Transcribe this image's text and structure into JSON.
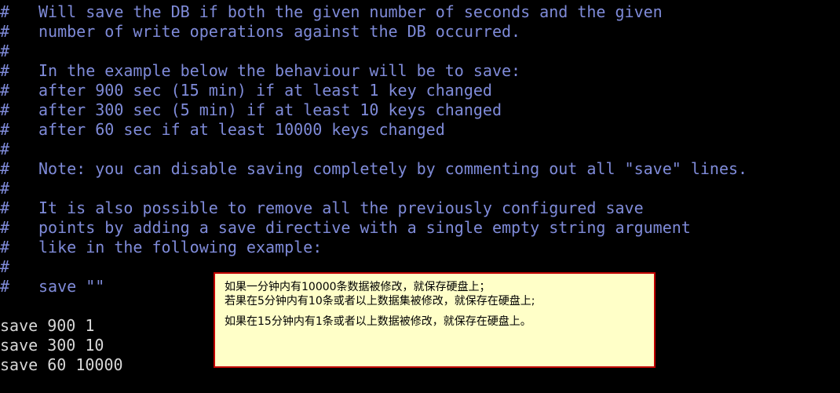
{
  "terminal": {
    "comment_lines": [
      {
        "hash": "#",
        "text": "Will save the DB if both the given number of seconds and the given"
      },
      {
        "hash": "#",
        "text": "number of write operations against the DB occurred."
      },
      {
        "hash": "#",
        "text": ""
      },
      {
        "hash": "#",
        "text": "In the example below the behaviour will be to save:"
      },
      {
        "hash": "#",
        "text": "after 900 sec (15 min) if at least 1 key changed"
      },
      {
        "hash": "#",
        "text": "after 300 sec (5 min) if at least 10 keys changed"
      },
      {
        "hash": "#",
        "text": "after 60 sec if at least 10000 keys changed"
      },
      {
        "hash": "#",
        "text": ""
      },
      {
        "hash": "#",
        "text": "Note: you can disable saving completely by commenting out all \"save\" lines."
      },
      {
        "hash": "#",
        "text": ""
      },
      {
        "hash": "#",
        "text": "It is also possible to remove all the previously configured save"
      },
      {
        "hash": "#",
        "text": "points by adding a save directive with a single empty string argument"
      },
      {
        "hash": "#",
        "text": "like in the following example:"
      },
      {
        "hash": "#",
        "text": ""
      },
      {
        "hash": "#",
        "text": "save \"\""
      }
    ],
    "code_lines": [
      "save 900 1",
      "save 300 10",
      "save 60 10000"
    ]
  },
  "note": {
    "line1": "如果一分钟内有10000条数据被修改，就保存硬盘上；",
    "line2": "若果在5分钟内有10条或者以上数据集被修改，就保存在硬盘上;",
    "line3": "如果在15分钟内有1条或者以上数据被修改，就保存在硬盘上。"
  },
  "colors": {
    "background": "#000000",
    "comment": "#7f8bd9",
    "code": "#d8d8d8",
    "note_background": "#ffffc8",
    "note_border": "#c00000"
  }
}
